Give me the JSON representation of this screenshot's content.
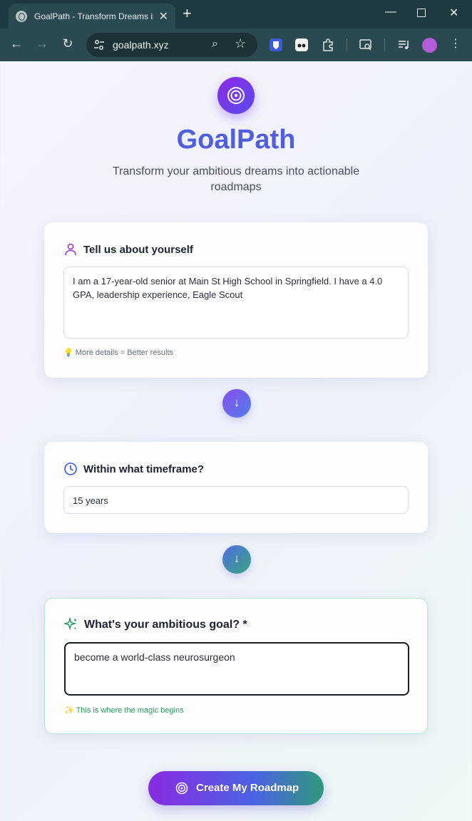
{
  "browser": {
    "tab_title": "GoalPath - Transform Dreams into Actionable Roadmaps",
    "url": "goalpath.xyz"
  },
  "header": {
    "brand": "GoalPath",
    "tagline": "Transform your ambitious dreams into actionable roadmaps"
  },
  "about": {
    "title": "Tell us about yourself",
    "value": "I am a 17-year-old senior at Main St High School in Springfield. I have a 4.0 GPA, leadership experience, Eagle Scout",
    "hint": "More details = Better results"
  },
  "timeframe": {
    "title": "Within what timeframe?",
    "value": "15 years"
  },
  "goal": {
    "title": "What's your ambitious goal? *",
    "value": "become a world-class neurosurgeon",
    "hint": "This is where the magic begins"
  },
  "cta": {
    "label": "Create My Roadmap"
  },
  "colors": {
    "brand": "#4f5fe0",
    "accent_purple": "#8b2be2",
    "accent_green": "#2f9a78"
  }
}
